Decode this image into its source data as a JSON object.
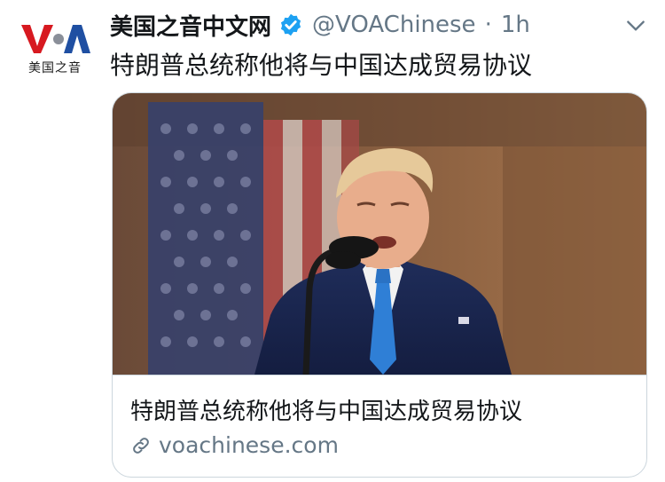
{
  "avatar": {
    "logo_text": "VOA",
    "subtitle": "美国之音"
  },
  "tweet": {
    "display_name": "美国之音中文网",
    "verified": true,
    "handle": "@VOAChinese",
    "separator": "·",
    "time": "1h",
    "text": "特朗普总统称他将与中国达成贸易协议"
  },
  "card": {
    "title": "特朗普总统称他将与中国达成贸易协议",
    "domain": "voachinese.com"
  },
  "colors": {
    "verified": "#1da1f2",
    "muted": "#657786",
    "voa_red": "#d71920",
    "voa_blue": "#1f4fa2"
  },
  "icons": [
    "verified-badge-icon",
    "chevron-down-icon",
    "link-icon"
  ]
}
